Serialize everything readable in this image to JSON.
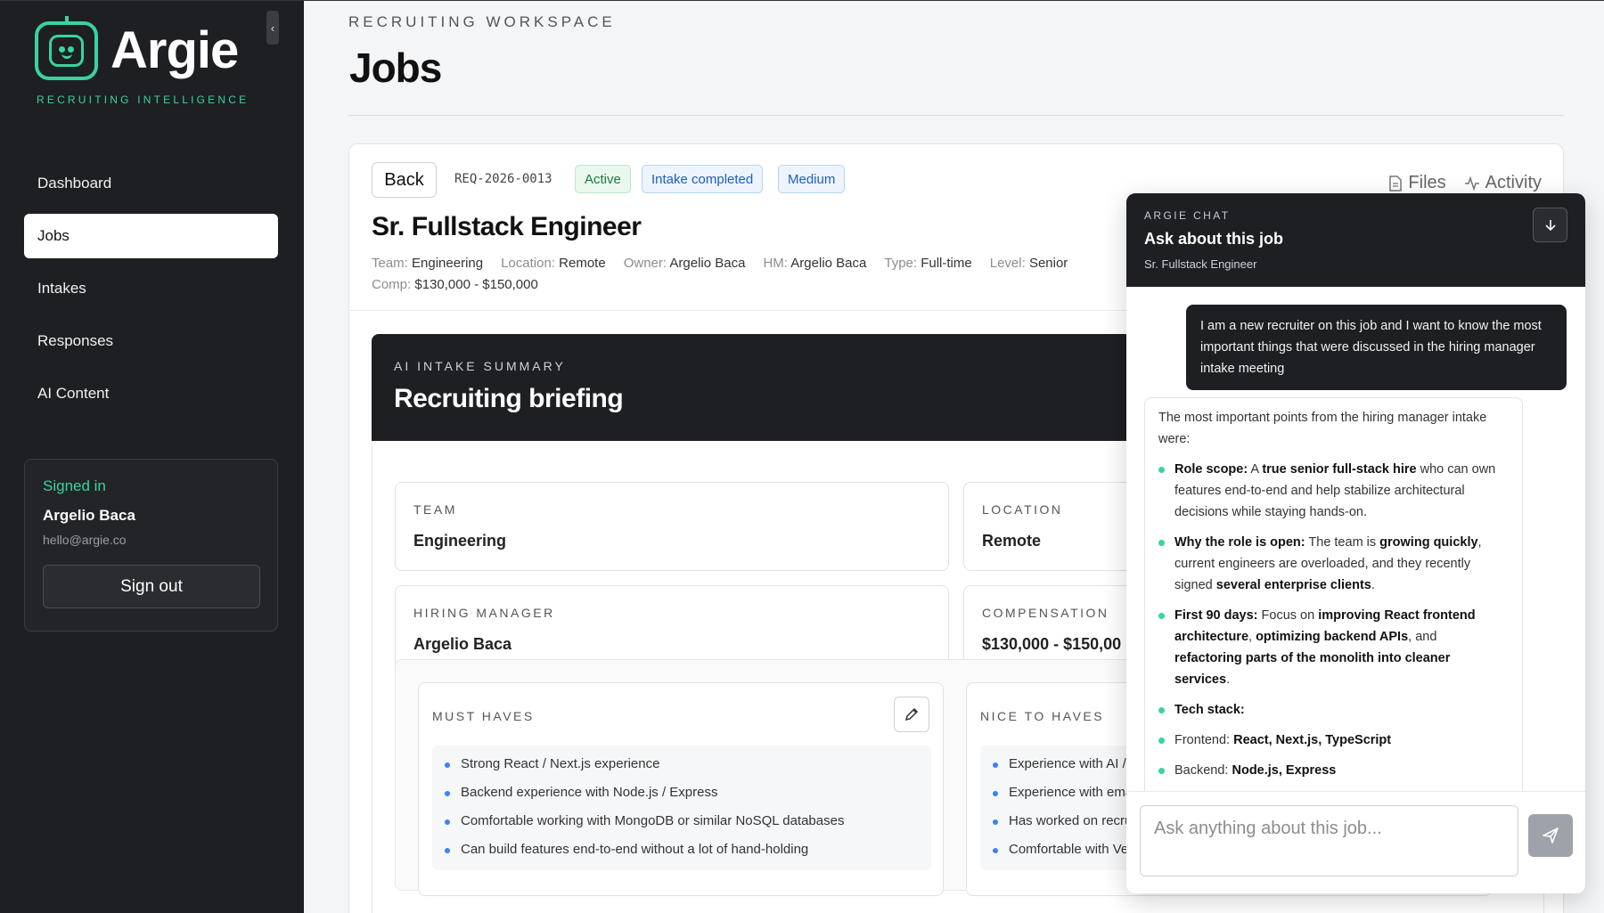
{
  "brand": {
    "name": "Argie",
    "tagline": "RECRUITING INTELLIGENCE",
    "accent": "#38d39f"
  },
  "sidebar": {
    "collapse_icon": "‹",
    "items": [
      {
        "label": "Dashboard"
      },
      {
        "label": "Jobs",
        "active": true
      },
      {
        "label": "Intakes"
      },
      {
        "label": "Responses"
      },
      {
        "label": "AI Content"
      }
    ],
    "account": {
      "status": "Signed in",
      "name": "Argelio Baca",
      "email": "hello@argie.co",
      "signout": "Sign out"
    }
  },
  "header": {
    "eyebrow": "RECRUITING WORKSPACE",
    "title": "Jobs"
  },
  "job": {
    "back": "Back",
    "req_id": "REQ-2026-0013",
    "badges": {
      "status": "Active",
      "intake": "Intake completed",
      "priority": "Medium"
    },
    "title": "Sr. Fullstack Engineer",
    "meta": [
      {
        "k": "Team:",
        "v": "Engineering"
      },
      {
        "k": "Location:",
        "v": "Remote"
      },
      {
        "k": "Owner:",
        "v": "Argelio Baca"
      },
      {
        "k": "HM:",
        "v": "Argelio Baca"
      },
      {
        "k": "Type:",
        "v": "Full-time"
      },
      {
        "k": "Level:",
        "v": "Senior"
      }
    ],
    "comp": {
      "k": "Comp:",
      "v": "$130,000 - $150,000"
    },
    "links": {
      "files": "Files",
      "activity": "Activity"
    }
  },
  "briefing": {
    "eyebrow": "AI INTAKE SUMMARY",
    "title": "Recruiting briefing",
    "fields": [
      {
        "label": "TEAM",
        "value": "Engineering"
      },
      {
        "label": "LOCATION",
        "value": "Remote"
      },
      {
        "label": "HIRING MANAGER",
        "value": "Argelio Baca"
      },
      {
        "label": "COMPENSATION",
        "value": "$130,000 - $150,00"
      }
    ],
    "must_haves": {
      "label": "MUST HAVES",
      "items": [
        "Strong React / Next.js experience",
        "Backend experience with Node.js / Express",
        "Comfortable working with MongoDB or similar NoSQL databases",
        "Can build features end-to-end without a lot of hand-holding"
      ]
    },
    "nice_to_haves": {
      "label": "NICE TO HAVES",
      "items": [
        "Experience with AI /",
        "Experience with ema",
        "Has worked on recru",
        "Comfortable with Ve"
      ]
    }
  },
  "chat": {
    "eyebrow": "ARGIE CHAT",
    "title": "Ask about this job",
    "subtitle": "Sr. Fullstack Engineer",
    "user_message": "I am a new recruiter on this job and I want to know the most important things that were discussed in the hiring manager intake meeting",
    "bot_intro": "The most important points from the hiring manager intake were:",
    "bot_points": [
      {
        "h": "Role scope:",
        "parts": [
          " A ",
          "true senior full-stack hire",
          " who can own features end-to-end and help stabilize architectural decisions while staying hands-on."
        ]
      },
      {
        "h": "Why the role is open:",
        "parts": [
          " The team is ",
          "growing quickly",
          ", current engineers are overloaded, and they recently signed ",
          "several enterprise clients",
          "."
        ]
      },
      {
        "h": "First 90 days:",
        "parts": [
          " Focus on ",
          "improving React frontend architecture",
          ", ",
          "optimizing backend APIs",
          ", and ",
          "refactoring parts of the monolith into cleaner services",
          "."
        ]
      },
      {
        "h": "Tech stack:",
        "parts": []
      },
      {
        "h": "",
        "parts": [
          "Frontend: ",
          "React, Next.js, TypeScript"
        ]
      },
      {
        "h": "",
        "parts": [
          "Backend: ",
          "Node.js, Express"
        ]
      }
    ],
    "input_placeholder": "Ask anything about this job..."
  }
}
